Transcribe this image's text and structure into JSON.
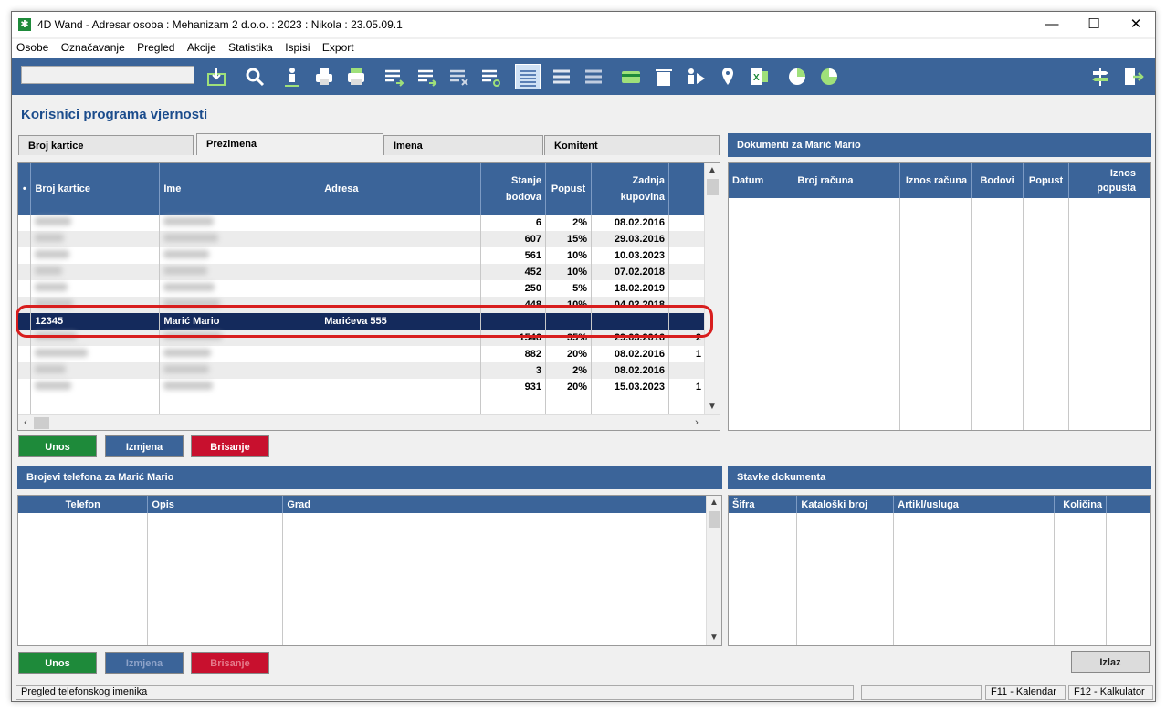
{
  "window": {
    "title": "4D Wand - Adresar osoba : Mehanizam 2 d.o.o. : 2023 : Nikola : 23.05.09.1",
    "minimize": "—",
    "maximize": "☐",
    "close": "✕"
  },
  "menu": [
    "Osobe",
    "Označavanje",
    "Pregled",
    "Akcije",
    "Statistika",
    "Ispisi",
    "Export"
  ],
  "page_title": "Korisnici programa vjernosti",
  "tabs": [
    "Broj kartice",
    "Prezimena",
    "Imena",
    "Komitent"
  ],
  "cards": {
    "columns": [
      "Broj kartice",
      "Ime",
      "Adresa",
      "Stanje bodova",
      "Popust",
      "Zadnja kupovina"
    ],
    "rows": [
      {
        "stanje": "6",
        "popust": "2%",
        "zadnja": "08.02.2016",
        "extra": ""
      },
      {
        "stanje": "607",
        "popust": "15%",
        "zadnja": "29.03.2016",
        "extra": ""
      },
      {
        "stanje": "561",
        "popust": "10%",
        "zadnja": "10.03.2023",
        "extra": ""
      },
      {
        "stanje": "452",
        "popust": "10%",
        "zadnja": "07.02.2018",
        "extra": ""
      },
      {
        "stanje": "250",
        "popust": "5%",
        "zadnja": "18.02.2019",
        "extra": ""
      },
      {
        "stanje": "448",
        "popust": "10%",
        "zadnja": "04.02.2018",
        "extra": ""
      },
      {
        "broj": "12345",
        "ime": "Marić Mario",
        "adresa": "Marićeva 555",
        "stanje": "",
        "popust": "",
        "zadnja": "",
        "extra": ""
      },
      {
        "stanje": "1546",
        "popust": "35%",
        "zadnja": "29.03.2016",
        "extra": "2"
      },
      {
        "stanje": "882",
        "popust": "20%",
        "zadnja": "08.02.2016",
        "extra": "1"
      },
      {
        "stanje": "3",
        "popust": "2%",
        "zadnja": "08.02.2016",
        "extra": ""
      },
      {
        "stanje": "931",
        "popust": "20%",
        "zadnja": "15.03.2023",
        "extra": "1"
      }
    ]
  },
  "documents": {
    "header": "Dokumenti za Marić Mario",
    "columns": [
      "Datum",
      "Broj računa",
      "Iznos računa",
      "Bodovi",
      "Popust",
      "Iznos popusta"
    ]
  },
  "buttons_top": {
    "unos": "Unos",
    "izmjena": "Izmjena",
    "brisanje": "Brisanje"
  },
  "phones": {
    "header": "Brojevi telefona za Marić Mario",
    "columns": [
      "Telefon",
      "Opis",
      "Grad"
    ]
  },
  "items": {
    "header": "Stavke dokumenta",
    "columns": [
      "Šifra",
      "Kataloški broj",
      "Artikl/usluga",
      "Količina"
    ]
  },
  "buttons_bottom": {
    "unos": "Unos",
    "izmjena": "Izmjena",
    "brisanje": "Brisanje",
    "izlaz": "Izlaz"
  },
  "status": {
    "message": "Pregled telefonskog imenika",
    "f11": "F11 - Kalendar",
    "f12": "F12 - Kalkulator"
  },
  "colors": {
    "toolbar": "#3b6499",
    "selected_row": "#142a5c",
    "green_button": "#1e8a3a",
    "red_button": "#c8102e",
    "highlight": "#d81e1e"
  }
}
